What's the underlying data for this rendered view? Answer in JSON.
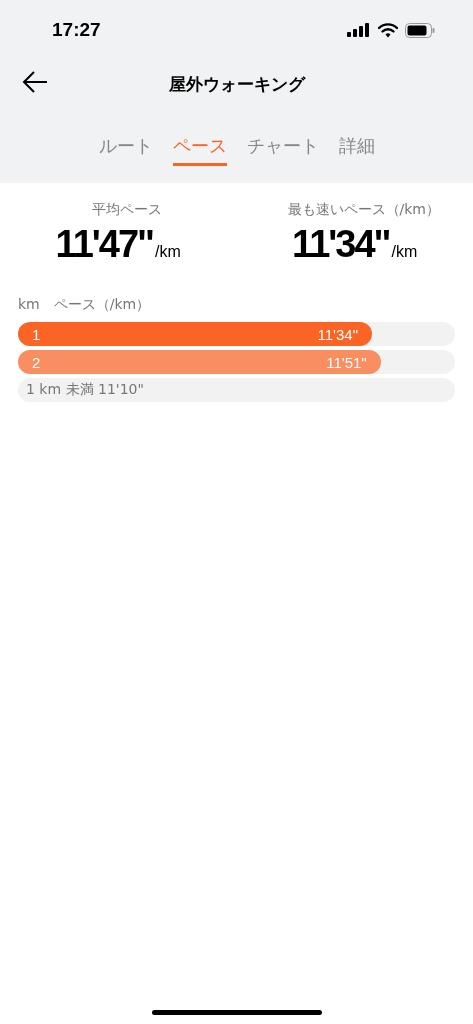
{
  "status_bar": {
    "time": "17:27"
  },
  "header": {
    "title": "屋外ウォーキング"
  },
  "tabs": [
    {
      "label": "ルート",
      "selected": false
    },
    {
      "label": "ペース",
      "selected": true
    },
    {
      "label": "チャート",
      "selected": false
    },
    {
      "label": "詳細",
      "selected": false
    }
  ],
  "summary": [
    {
      "label": "平均ペース",
      "value": "11'47\"",
      "unit": "/km"
    },
    {
      "label": "最も速いペース（/km）",
      "value": "11'34\"",
      "unit": "/km"
    }
  ],
  "splits": {
    "columns": [
      "km",
      "ペース（/km）"
    ],
    "rows": [
      {
        "kind": "bar",
        "km": "1",
        "pace": "11'34\"",
        "level": 0.81,
        "color": "#fb6424"
      },
      {
        "kind": "bar",
        "km": "2",
        "pace": "11'51\"",
        "level": 0.83,
        "color": "#f98f60"
      },
      {
        "kind": "remainder",
        "text": "1 km 未満 11'10\""
      }
    ]
  }
}
